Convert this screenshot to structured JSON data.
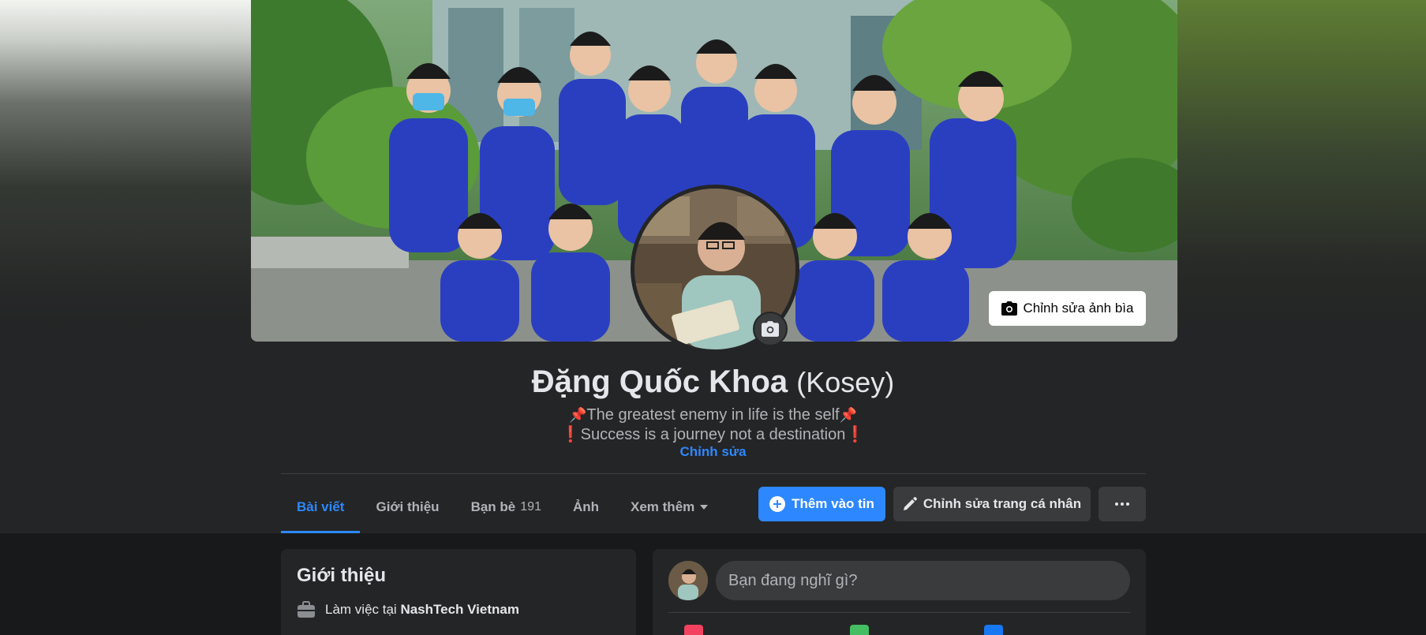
{
  "profile": {
    "name": "Đặng Quốc Khoa",
    "nickname": "(Kosey)",
    "bio_line1": "The greatest enemy in life is the self",
    "bio_line2": "Success is a journey not a destination",
    "bio_pin_icon": "pushpin-icon",
    "bio_exclaim_icon": "exclamation-icon",
    "edit_bio_label": "Chỉnh sửa"
  },
  "cover": {
    "edit_cover_label": "Chỉnh sửa ảnh bìa",
    "edit_cover_icon": "camera-icon"
  },
  "avatar": {
    "camera_icon": "camera-icon"
  },
  "tabs": [
    {
      "label": "Bài viết",
      "active": true
    },
    {
      "label": "Giới thiệu"
    },
    {
      "label": "Bạn bè",
      "count": "191"
    },
    {
      "label": "Ảnh"
    },
    {
      "label": "Xem thêm",
      "icon": "caret-down-icon"
    }
  ],
  "actions": {
    "add_story_label": "Thêm vào tin",
    "add_story_icon": "plus-circle-icon",
    "edit_profile_label": "Chỉnh sửa trang cá nhân",
    "edit_profile_icon": "pencil-icon",
    "more_icon": "ellipsis-icon"
  },
  "intro": {
    "title": "Giới thiệu",
    "work_prefix": "Làm việc tại",
    "work_company": "NashTech Vietnam",
    "work_icon": "briefcase-icon"
  },
  "composer": {
    "placeholder": "Bạn đang nghĩ gì?"
  },
  "colors": {
    "background": "#18191a",
    "surface": "#242526",
    "accent": "#2d88ff",
    "button_secondary": "#3a3b3c",
    "text_primary": "#e4e6eb",
    "text_secondary": "#b0b3b8"
  }
}
